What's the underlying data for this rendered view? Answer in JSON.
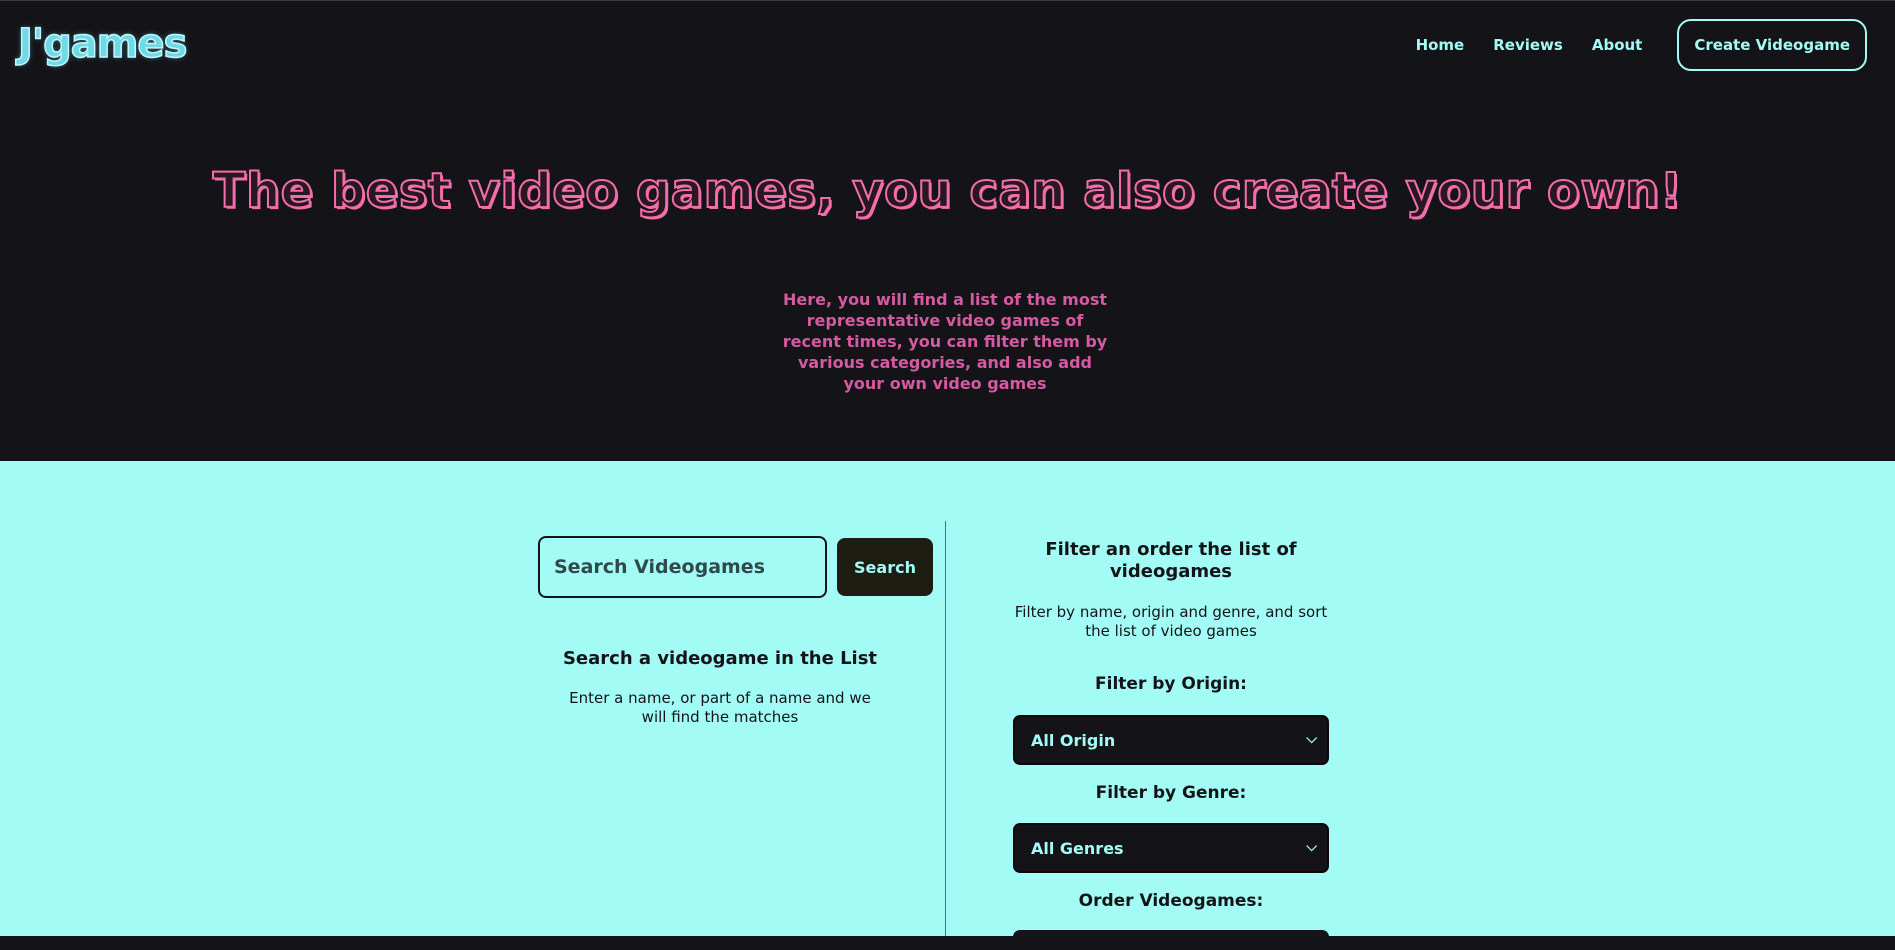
{
  "header": {
    "logo": "J'games",
    "nav": [
      {
        "label": "Home"
      },
      {
        "label": "Reviews"
      },
      {
        "label": "About"
      }
    ],
    "create_button": "Create Videogame"
  },
  "hero": {
    "title": "The best video games, you can also create your own!",
    "description": "Here, you will find a list of the most representative video games of recent times, you can filter them by various categories, and also add your own video games"
  },
  "search": {
    "placeholder": "Search Videogames",
    "value": "",
    "button_label": "Search",
    "title": "Search a videogame in the List",
    "description": "Enter a name, or part of a name and we will find the matches"
  },
  "filters": {
    "title": "Filter an order the list of videogames",
    "description": "Filter by name, origin and genre, and sort the list of video games",
    "origin_label": "Filter by Origin:",
    "origin_selected": "All Origin",
    "genre_label": "Filter by Genre:",
    "genre_selected": "All Genres",
    "order_label": "Order Videogames:"
  },
  "colors": {
    "dark_bg": "#141418",
    "cyan_bg": "#a3fbf6",
    "pink": "#f26dac",
    "pink_text": "#d45aa1"
  }
}
